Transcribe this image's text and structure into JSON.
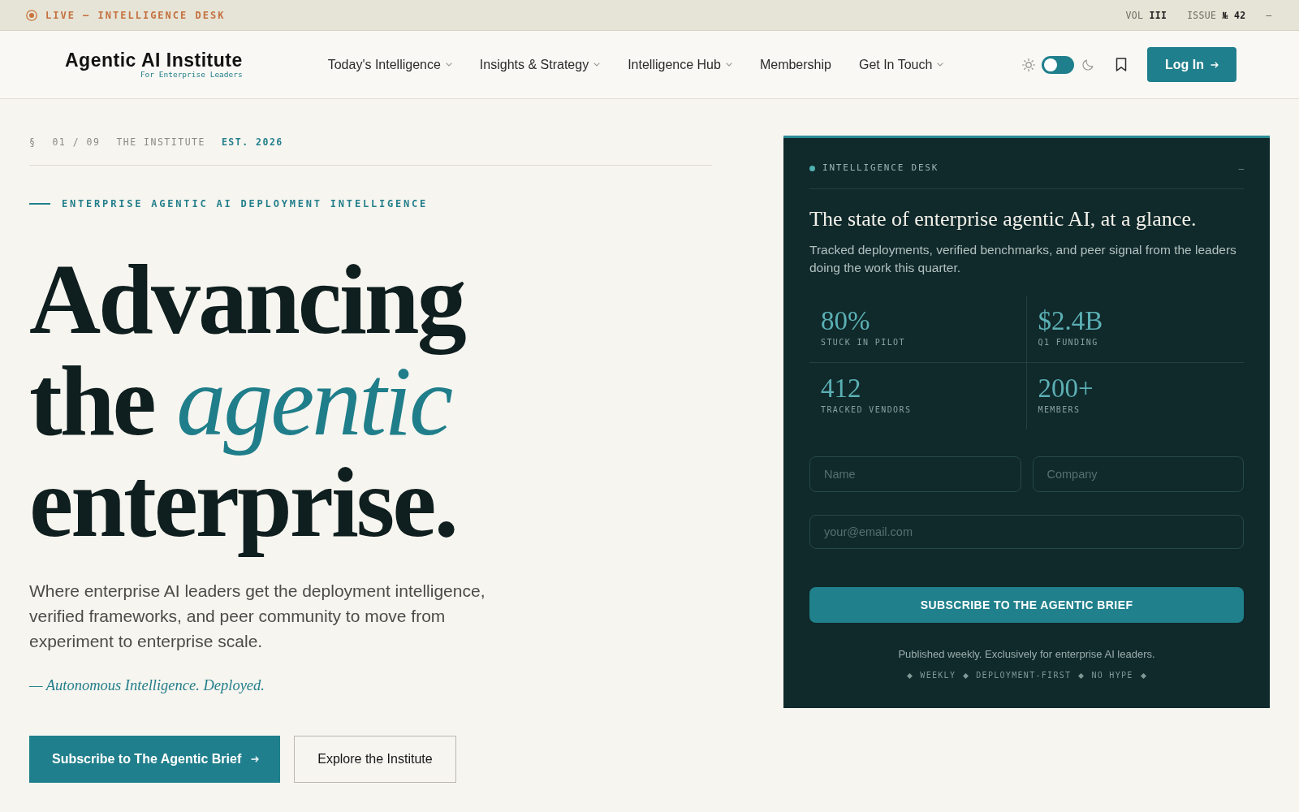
{
  "top_bar": {
    "live_label": "LIVE — INTELLIGENCE DESK",
    "volume": "VOL **III**",
    "issue": "ISSUE **№ 42**",
    "collapse_glyph": "—"
  },
  "header": {
    "logo": {
      "name": "Agentic AI Institute",
      "tagline": "For Enterprise Leaders"
    },
    "nav": [
      {
        "label": "Today's Intelligence",
        "has_dropdown": true
      },
      {
        "label": "Insights & Strategy",
        "has_dropdown": true
      },
      {
        "label": "Intelligence Hub",
        "has_dropdown": true
      },
      {
        "label": "Membership",
        "has_dropdown": false
      },
      {
        "label": "Get In Touch",
        "has_dropdown": true
      }
    ],
    "theme_toggle": {
      "on": false
    },
    "login_button": "Log In"
  },
  "hero": {
    "section_marker": {
      "symbol": "§",
      "index": "01 / 09",
      "name": "THE INSTITUTE",
      "established": "EST. 2026"
    },
    "eyebrow": "ENTERPRISE AGENTIC AI DEPLOYMENT INTELLIGENCE",
    "headline_lines": [
      "Advancing",
      "the *agentic*",
      "enterprise."
    ],
    "description": "Where enterprise AI leaders get the deployment intelligence, verified frameworks, and peer community to move from experiment to enterprise scale.",
    "tagline": "— Autonomous Intelligence. Deployed.",
    "buttons": [
      {
        "label": "Subscribe to The Agentic Brief",
        "kind": "primary"
      },
      {
        "label": "Explore the Institute",
        "kind": "secondary"
      }
    ]
  },
  "intelligence_desk": {
    "label": "INTELLIGENCE DESK",
    "collapse_glyph": "—",
    "title": "The state of enterprise agentic AI, at a glance.",
    "description": "Tracked deployments, verified benchmarks, and peer signal from the leaders doing the work this quarter.",
    "stats": [
      {
        "value": "80%",
        "label": "STUCK IN PILOT"
      },
      {
        "value": "$2.4B",
        "label": "Q1 FUNDING"
      },
      {
        "value": "412",
        "label": "TRACKED VENDORS"
      },
      {
        "value": "200+",
        "label": "MEMBERS"
      }
    ],
    "form": {
      "rows": [
        [
          {
            "placeholder": "Name"
          },
          {
            "placeholder": "Company"
          }
        ],
        [
          {
            "placeholder": "your@email.com"
          }
        ]
      ],
      "submit": "SUBSCRIBE TO THE AGENTIC BRIEF",
      "note": "Published weekly. Exclusively for enterprise AI leaders.",
      "tags": [
        "WEEKLY",
        "DEPLOYMENT-FIRST",
        "NO HYPE"
      ]
    }
  }
}
